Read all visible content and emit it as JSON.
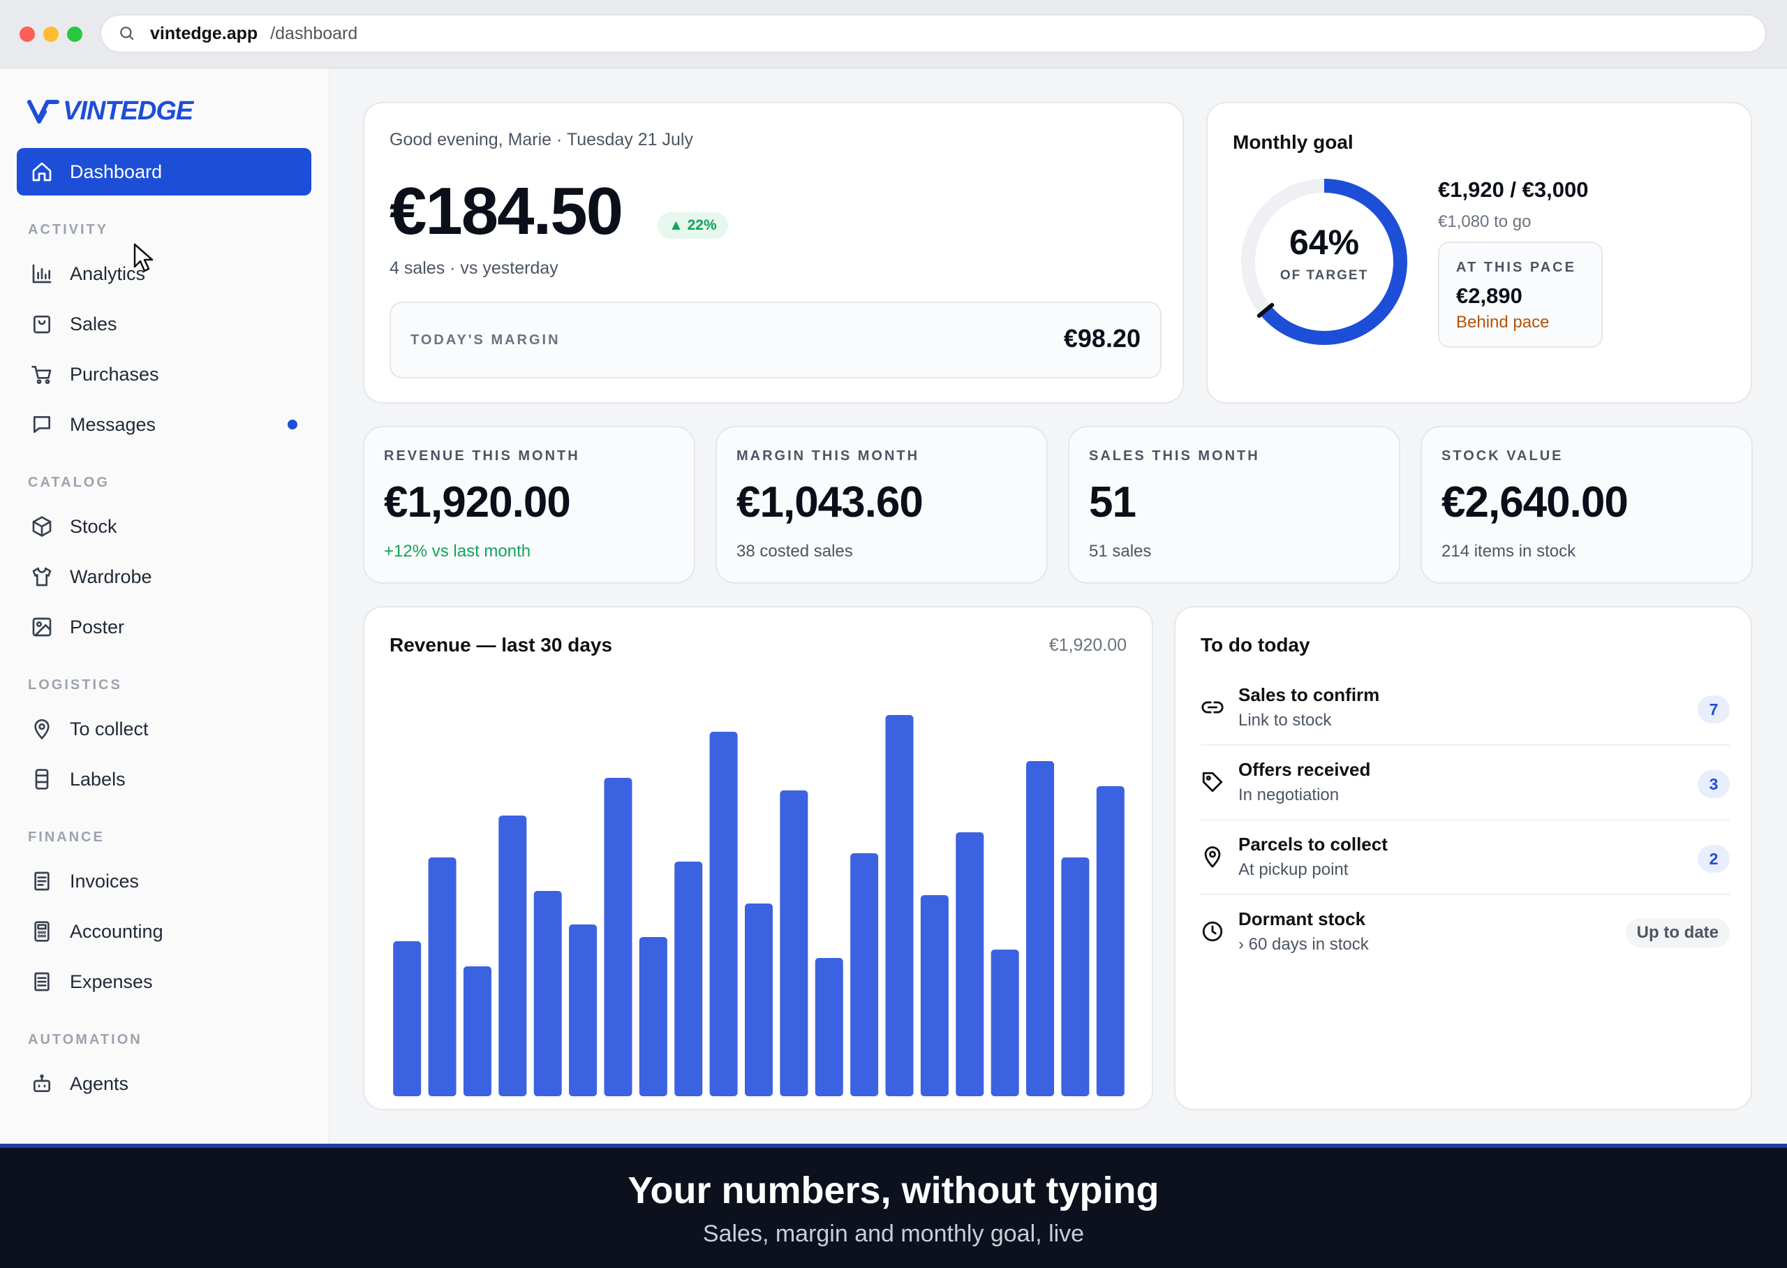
{
  "browser": {
    "host": "vintedge.app",
    "path": "/dashboard"
  },
  "brand": {
    "name": "VINTEDGE",
    "accent": "#1d4ed8"
  },
  "sidebar": {
    "dashboard": "Dashboard",
    "sections": {
      "activity": "ACTIVITY",
      "catalog": "CATALOG",
      "logistics": "LOGISTICS",
      "finance": "FINANCE",
      "automation": "AUTOMATION"
    },
    "items": {
      "analytics": "Analytics",
      "sales": "Sales",
      "purchases": "Purchases",
      "messages": "Messages",
      "stock": "Stock",
      "wardrobe": "Wardrobe",
      "poster": "Poster",
      "to_collect": "To collect",
      "labels": "Labels",
      "invoices": "Invoices",
      "accounting": "Accounting",
      "expenses": "Expenses",
      "agents": "Agents"
    }
  },
  "today": {
    "greeting": "Good evening, Marie · Tuesday 21 July",
    "amount": "€184.50",
    "change": "▲ 22%",
    "sub": "4 sales · vs yesterday",
    "margin_label": "TODAY'S MARGIN",
    "margin_value": "€98.20"
  },
  "goal": {
    "title": "Monthly goal",
    "progress": 64,
    "percent_text": "64%",
    "percent_sub": "OF TARGET",
    "amount": "€1,920 / €3,000",
    "to_go": "€1,080 to go",
    "pace_label": "AT THIS PACE",
    "pace_value": "€2,890",
    "pace_status": "Behind pace"
  },
  "stats": [
    {
      "label": "REVENUE THIS MONTH",
      "value": "€1,920.00",
      "sub": "+12% vs last month"
    },
    {
      "label": "MARGIN THIS MONTH",
      "value": "€1,043.60",
      "sub": "38 costed sales"
    },
    {
      "label": "SALES THIS MONTH",
      "value": "51",
      "sub": "51 sales"
    },
    {
      "label": "STOCK VALUE",
      "value": "€2,640.00",
      "sub": "214 items in stock"
    }
  ],
  "chart_data": {
    "type": "bar",
    "title": "Revenue — last 30 days",
    "total": "€1,920.00",
    "color": "#3b62e0",
    "values": [
      37,
      57,
      31,
      67,
      49,
      41,
      76,
      38,
      56,
      87,
      46,
      73,
      33,
      58,
      91,
      48,
      63,
      35,
      80,
      57,
      74
    ],
    "ylim": [
      0,
      100
    ]
  },
  "todo": {
    "title": "To do today",
    "items": [
      {
        "name": "Sales to confirm",
        "desc": "Link to stock",
        "count": "7"
      },
      {
        "name": "Offers received",
        "desc": "In negotiation",
        "count": "3"
      },
      {
        "name": "Parcels to collect",
        "desc": "At pickup point",
        "count": "2"
      },
      {
        "name": "Dormant stock",
        "desc": "› 60 days in stock",
        "status": "Up to date"
      }
    ]
  },
  "caption": {
    "title": "Your numbers, without typing",
    "subtitle": "Sales, margin and monthly goal, live"
  }
}
